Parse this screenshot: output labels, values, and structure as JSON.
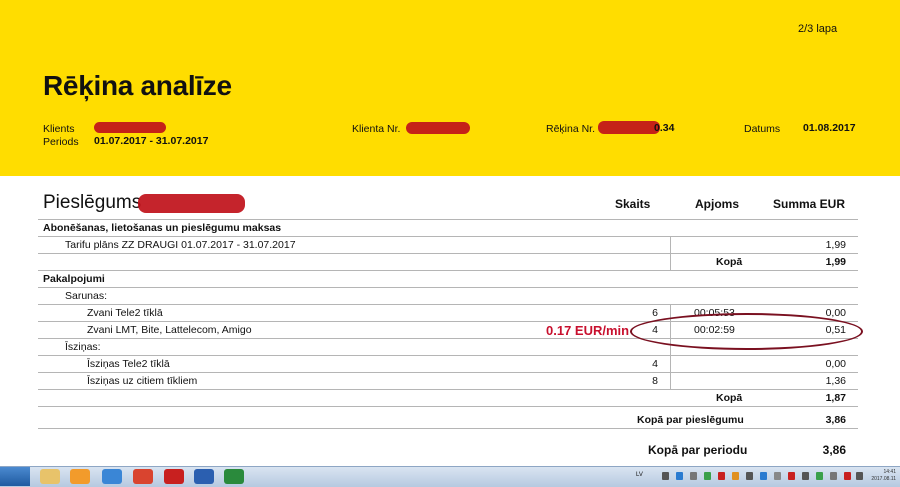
{
  "header": {
    "page": "2/3 lapa",
    "title": "Rēķina analīze",
    "client_label": "Klients",
    "period_label": "Periods",
    "period_value": "01.07.2017 - 31.07.2017",
    "client_no_label": "Klienta Nr.",
    "invoice_no_label": "Rēķina Nr.",
    "invoice_no_visible": "0.34",
    "date_label": "Datums",
    "date_value": "01.08.2017",
    "accent_color": "#ffdd00"
  },
  "connection": {
    "title": "Pieslēgums",
    "col_count": "Skaits",
    "col_volume": "Apjoms",
    "col_sum": "Summa EUR"
  },
  "sections": {
    "subscription": {
      "title": "Abonēšanas, lietošanas un pieslēgumu maksas",
      "tariff_label": "Tarifu plāns ZZ DRAUGI 01.07.2017 - 31.07.2017",
      "tariff_sum": "1,99",
      "total_label": "Kopā",
      "total_sum": "1,99"
    },
    "services": {
      "title": "Pakalpojumi",
      "calls_label": "Sarunas:",
      "calls_tele2_label": "Zvani Tele2 tīklā",
      "calls_tele2_count": "6",
      "calls_tele2_volume": "00:05:53",
      "calls_tele2_sum": "0,00",
      "calls_other_label": "Zvani LMT, Bite, Lattelecom, Amigo",
      "calls_other_count": "4",
      "calls_other_volume": "00:02:59",
      "calls_other_sum": "0,51",
      "sms_label": "Īsziņas:",
      "sms_tele2_label": "Īsziņas Tele2 tīklā",
      "sms_tele2_count": "4",
      "sms_tele2_sum": "0,00",
      "sms_other_label": "Īsziņas uz citiem tīkliem",
      "sms_other_count": "8",
      "sms_other_sum": "1,36",
      "total_label": "Kopā",
      "total_sum": "1,87"
    },
    "connection_total_label": "Kopā par pieslēgumu",
    "connection_total_sum": "3,86",
    "period_total_label": "Kopā par periodu",
    "period_total_sum": "3,86"
  },
  "annotation": {
    "text": "0.17 EUR/min",
    "color": "#c8102e"
  },
  "taskbar": {
    "apps": [
      "explorer-icon",
      "media-icon",
      "ie-icon",
      "chrome-icon",
      "pdf-icon",
      "word-icon",
      "excel-icon"
    ],
    "language": "LV",
    "clock_time": "14:41",
    "clock_date": "2017.08.11"
  }
}
